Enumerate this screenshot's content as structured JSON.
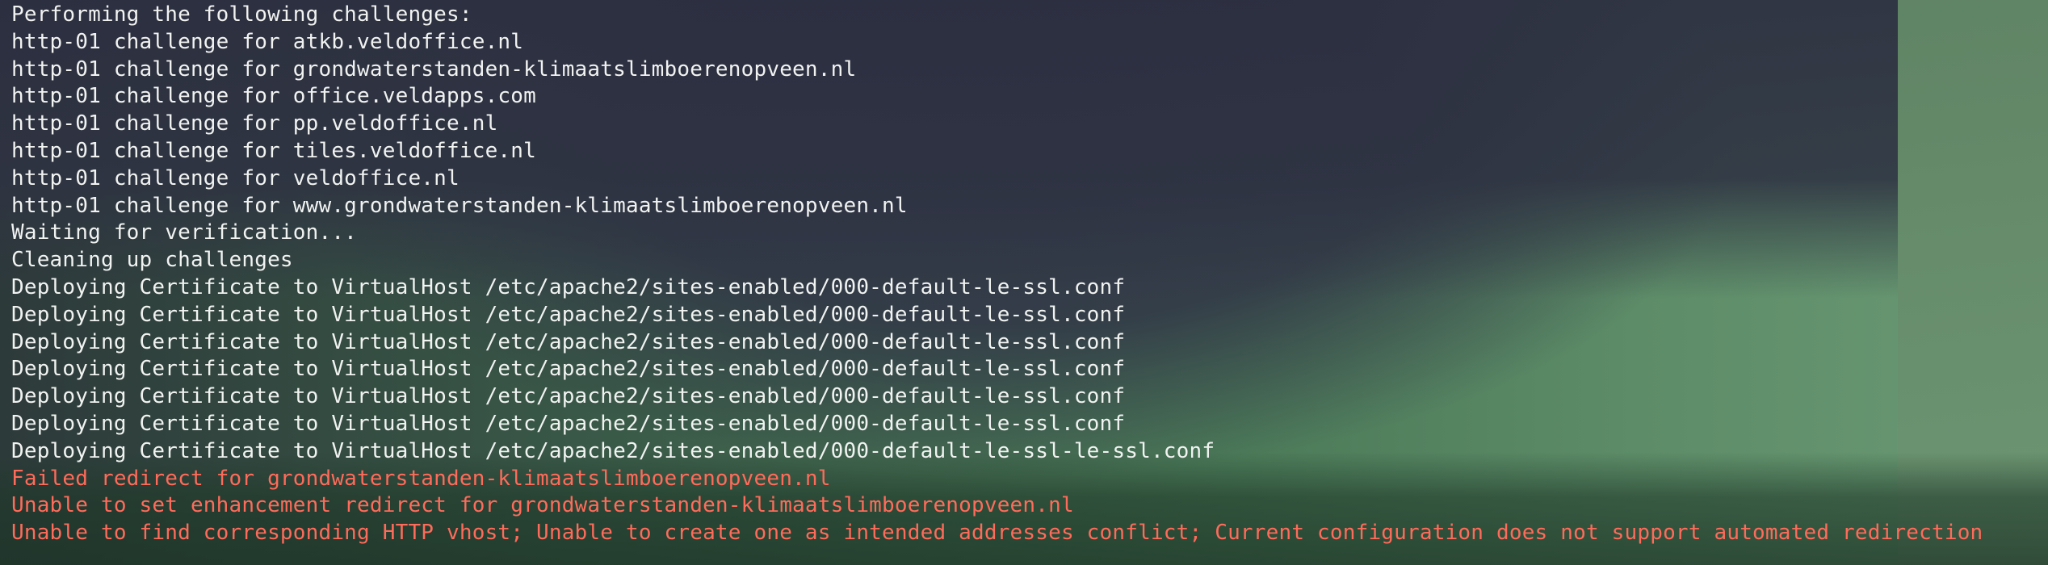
{
  "terminal": {
    "lines": [
      {
        "text": "Performing the following challenges:",
        "kind": "normal"
      },
      {
        "text": "http-01 challenge for atkb.veldoffice.nl",
        "kind": "normal"
      },
      {
        "text": "http-01 challenge for grondwaterstanden-klimaatslimboerenopveen.nl",
        "kind": "normal"
      },
      {
        "text": "http-01 challenge for office.veldapps.com",
        "kind": "normal"
      },
      {
        "text": "http-01 challenge for pp.veldoffice.nl",
        "kind": "normal"
      },
      {
        "text": "http-01 challenge for tiles.veldoffice.nl",
        "kind": "normal"
      },
      {
        "text": "http-01 challenge for veldoffice.nl",
        "kind": "normal"
      },
      {
        "text": "http-01 challenge for www.grondwaterstanden-klimaatslimboerenopveen.nl",
        "kind": "normal"
      },
      {
        "text": "Waiting for verification...",
        "kind": "normal"
      },
      {
        "text": "Cleaning up challenges",
        "kind": "normal"
      },
      {
        "text": "Deploying Certificate to VirtualHost /etc/apache2/sites-enabled/000-default-le-ssl.conf",
        "kind": "normal"
      },
      {
        "text": "Deploying Certificate to VirtualHost /etc/apache2/sites-enabled/000-default-le-ssl.conf",
        "kind": "normal"
      },
      {
        "text": "Deploying Certificate to VirtualHost /etc/apache2/sites-enabled/000-default-le-ssl.conf",
        "kind": "normal"
      },
      {
        "text": "Deploying Certificate to VirtualHost /etc/apache2/sites-enabled/000-default-le-ssl.conf",
        "kind": "normal"
      },
      {
        "text": "Deploying Certificate to VirtualHost /etc/apache2/sites-enabled/000-default-le-ssl.conf",
        "kind": "normal"
      },
      {
        "text": "Deploying Certificate to VirtualHost /etc/apache2/sites-enabled/000-default-le-ssl.conf",
        "kind": "normal"
      },
      {
        "text": "Deploying Certificate to VirtualHost /etc/apache2/sites-enabled/000-default-le-ssl-le-ssl.conf",
        "kind": "normal"
      },
      {
        "text": "Failed redirect for grondwaterstanden-klimaatslimboerenopveen.nl",
        "kind": "error"
      },
      {
        "text": "Unable to set enhancement redirect for grondwaterstanden-klimaatslimboerenopveen.nl",
        "kind": "error"
      },
      {
        "text": "Unable to find corresponding HTTP vhost; Unable to create one as intended addresses conflict; Current configuration does not support automated redirection",
        "kind": "error"
      }
    ]
  },
  "colors": {
    "normal_text": "#f1f3f1",
    "error_text": "#ff6b5a"
  }
}
